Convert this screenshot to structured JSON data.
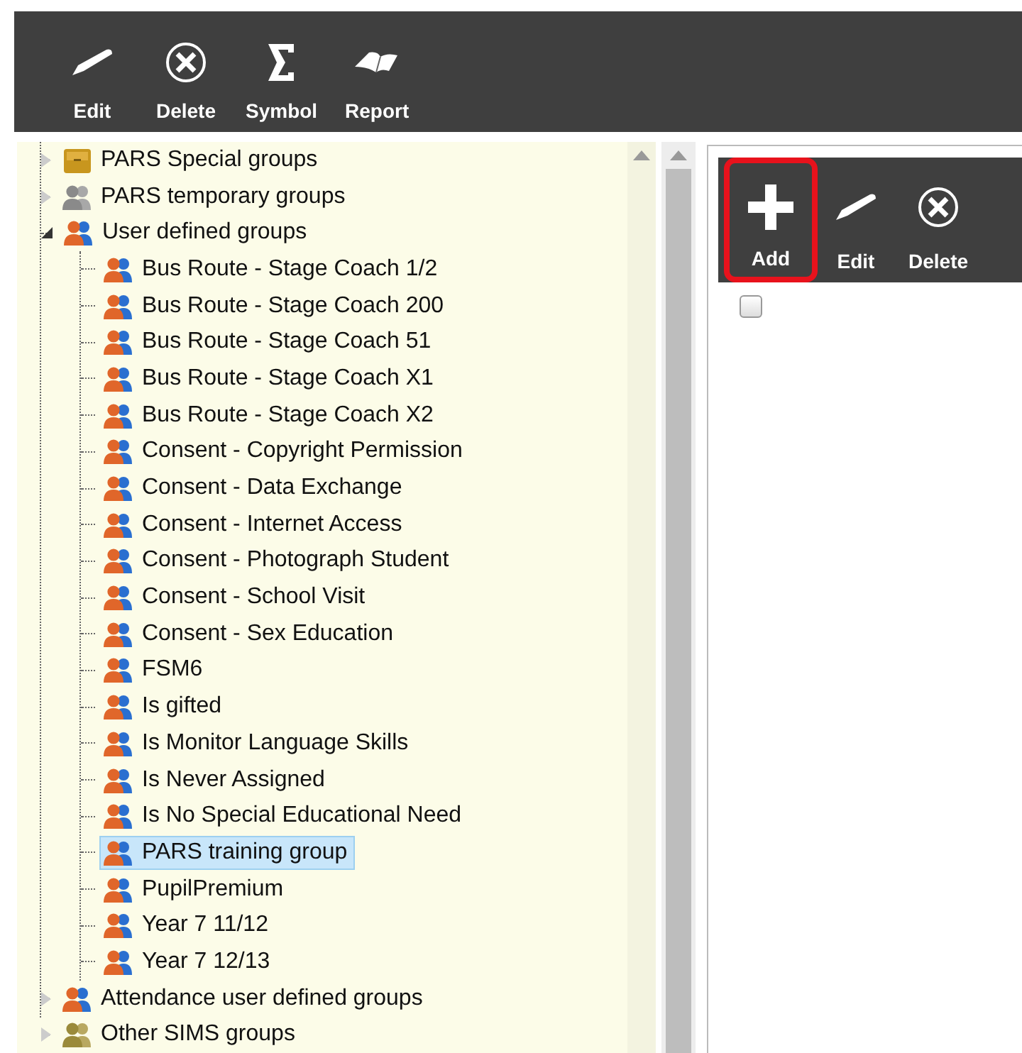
{
  "toolbar": {
    "buttons": [
      {
        "label": "Edit",
        "kind": "edit",
        "highlighted": false
      },
      {
        "label": "Delete",
        "kind": "delete",
        "highlighted": false
      },
      {
        "label": "Symbol",
        "kind": "symbol",
        "highlighted": false
      },
      {
        "label": "Report",
        "kind": "report",
        "highlighted": false
      }
    ]
  },
  "tree": {
    "items": [
      {
        "label": "PARS Special groups",
        "kind": "folder",
        "expanded": false,
        "selected": false
      },
      {
        "label": "PARS temporary groups",
        "kind": "grey-group",
        "expanded": false,
        "selected": false
      },
      {
        "label": "User defined groups",
        "kind": "group",
        "expanded": true,
        "selected": false,
        "children": [
          {
            "label": "Bus Route - Stage Coach 1/2",
            "kind": "group",
            "selected": false
          },
          {
            "label": "Bus Route - Stage Coach 200",
            "kind": "group",
            "selected": false
          },
          {
            "label": "Bus Route - Stage Coach 51",
            "kind": "group",
            "selected": false
          },
          {
            "label": "Bus Route - Stage Coach X1",
            "kind": "group",
            "selected": false
          },
          {
            "label": "Bus Route - Stage Coach X2",
            "kind": "group",
            "selected": false
          },
          {
            "label": "Consent - Copyright Permission",
            "kind": "group",
            "selected": false
          },
          {
            "label": "Consent - Data Exchange",
            "kind": "group",
            "selected": false
          },
          {
            "label": "Consent - Internet Access",
            "kind": "group",
            "selected": false
          },
          {
            "label": "Consent - Photograph Student",
            "kind": "group",
            "selected": false
          },
          {
            "label": "Consent - School Visit",
            "kind": "group",
            "selected": false
          },
          {
            "label": "Consent - Sex Education",
            "kind": "group",
            "selected": false
          },
          {
            "label": "FSM6",
            "kind": "group",
            "selected": false
          },
          {
            "label": "Is gifted",
            "kind": "group",
            "selected": false
          },
          {
            "label": "Is Monitor Language Skills",
            "kind": "group",
            "selected": false
          },
          {
            "label": "Is Never Assigned",
            "kind": "group",
            "selected": false
          },
          {
            "label": "Is No Special Educational Need",
            "kind": "group",
            "selected": false
          },
          {
            "label": "PARS training group",
            "kind": "group",
            "selected": true
          },
          {
            "label": "PupilPremium",
            "kind": "group",
            "selected": false
          },
          {
            "label": "Year 7 11/12",
            "kind": "group",
            "selected": false
          },
          {
            "label": "Year 7 12/13",
            "kind": "group",
            "selected": false
          }
        ]
      },
      {
        "label": "Attendance user defined groups",
        "kind": "group",
        "expanded": false,
        "selected": false
      },
      {
        "label": "Other SIMS groups",
        "kind": "olive-group",
        "expanded": false,
        "selected": false
      }
    ]
  },
  "detail": {
    "toolbar": {
      "buttons": [
        {
          "label": "Add",
          "kind": "add",
          "highlighted": true
        },
        {
          "label": "Edit",
          "kind": "edit",
          "highlighted": false
        },
        {
          "label": "Delete",
          "kind": "delete",
          "highlighted": false
        }
      ]
    },
    "select_all": {
      "checked": false
    }
  }
}
